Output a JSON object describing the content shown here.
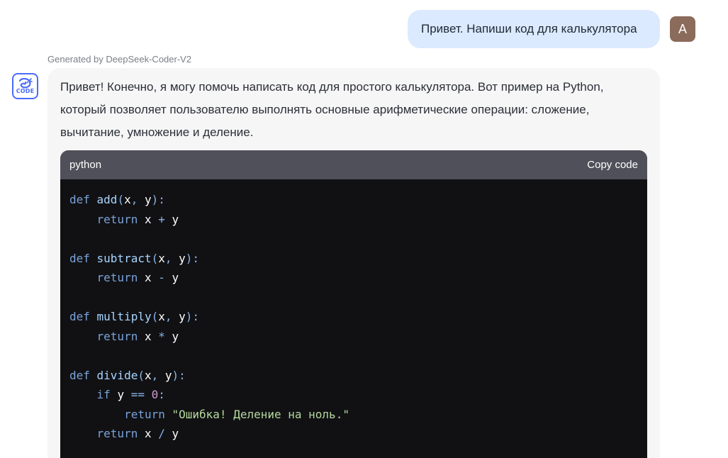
{
  "user_message": {
    "text": "Привет. Напиши код для калькулятора",
    "avatar_letter": "A",
    "avatar_color": "#8b6b5b",
    "bubble_color": "#dbeafe"
  },
  "assistant": {
    "model_label": "Generated by DeepSeek-Coder-V2",
    "avatar_icon": "deepseek-whale-code-icon",
    "avatar_text": "CODE",
    "intro_text": "Привет! Конечно, я могу помочь написать код для простого калькулятора. Вот пример на Python, который позволяет пользователю выполнять основные арифметические операции: сложение, вычитание, умножение и деление.",
    "code_block": {
      "language": "python",
      "copy_label": "Copy code",
      "lines": [
        [
          {
            "t": "def ",
            "c": "kw"
          },
          {
            "t": "add",
            "c": "fn"
          },
          {
            "t": "(",
            "c": "p"
          },
          {
            "t": "x",
            "c": "id"
          },
          {
            "t": ", ",
            "c": "p"
          },
          {
            "t": "y",
            "c": "id"
          },
          {
            "t": "):",
            "c": "p"
          }
        ],
        [
          {
            "t": "    return ",
            "c": "kw"
          },
          {
            "t": "x",
            "c": "id"
          },
          {
            "t": " + ",
            "c": "op"
          },
          {
            "t": "y",
            "c": "id"
          }
        ],
        [],
        [
          {
            "t": "def ",
            "c": "kw"
          },
          {
            "t": "subtract",
            "c": "fn"
          },
          {
            "t": "(",
            "c": "p"
          },
          {
            "t": "x",
            "c": "id"
          },
          {
            "t": ", ",
            "c": "p"
          },
          {
            "t": "y",
            "c": "id"
          },
          {
            "t": "):",
            "c": "p"
          }
        ],
        [
          {
            "t": "    return ",
            "c": "kw"
          },
          {
            "t": "x",
            "c": "id"
          },
          {
            "t": " - ",
            "c": "op"
          },
          {
            "t": "y",
            "c": "id"
          }
        ],
        [],
        [
          {
            "t": "def ",
            "c": "kw"
          },
          {
            "t": "multiply",
            "c": "fn"
          },
          {
            "t": "(",
            "c": "p"
          },
          {
            "t": "x",
            "c": "id"
          },
          {
            "t": ", ",
            "c": "p"
          },
          {
            "t": "y",
            "c": "id"
          },
          {
            "t": "):",
            "c": "p"
          }
        ],
        [
          {
            "t": "    return ",
            "c": "kw"
          },
          {
            "t": "x",
            "c": "id"
          },
          {
            "t": " * ",
            "c": "op"
          },
          {
            "t": "y",
            "c": "id"
          }
        ],
        [],
        [
          {
            "t": "def ",
            "c": "kw"
          },
          {
            "t": "divide",
            "c": "fn"
          },
          {
            "t": "(",
            "c": "p"
          },
          {
            "t": "x",
            "c": "id"
          },
          {
            "t": ", ",
            "c": "p"
          },
          {
            "t": "y",
            "c": "id"
          },
          {
            "t": "):",
            "c": "p"
          }
        ],
        [
          {
            "t": "    if ",
            "c": "kw"
          },
          {
            "t": "y",
            "c": "id"
          },
          {
            "t": " == ",
            "c": "op"
          },
          {
            "t": "0",
            "c": "num"
          },
          {
            "t": ":",
            "c": "p"
          }
        ],
        [
          {
            "t": "        return ",
            "c": "kw"
          },
          {
            "t": "\"Ошибка! Деление на ноль.\"",
            "c": "str"
          }
        ],
        [
          {
            "t": "    return ",
            "c": "kw"
          },
          {
            "t": "x",
            "c": "id"
          },
          {
            "t": " / ",
            "c": "op"
          },
          {
            "t": "y",
            "c": "id"
          }
        ]
      ]
    }
  }
}
